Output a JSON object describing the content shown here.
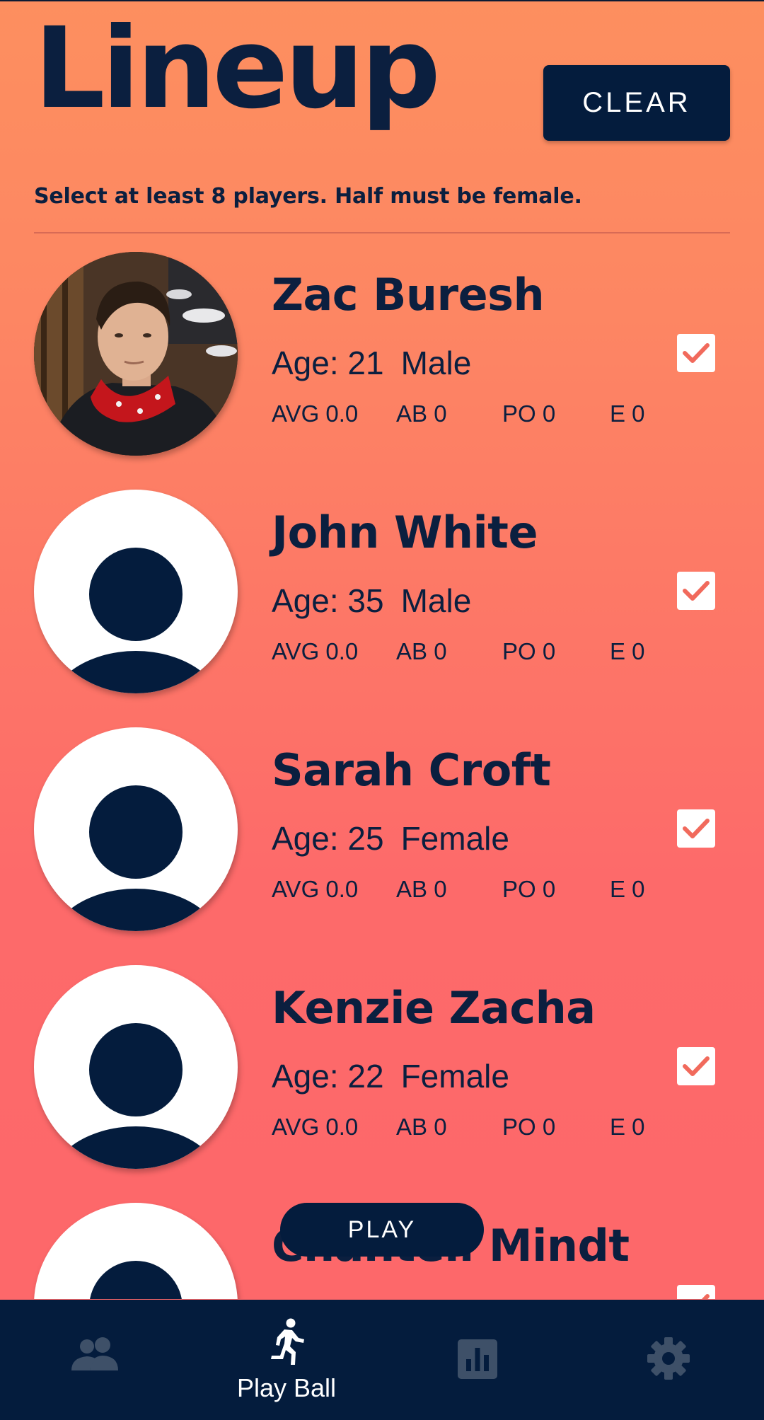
{
  "header": {
    "title": "Lineup",
    "clear_label": "CLEAR",
    "subtitle": "Select at least 8 players. Half must be female."
  },
  "players": [
    {
      "name": "Zac Buresh",
      "age_label": "Age: 21",
      "gender": "Male",
      "avg": "AVG 0.0",
      "ab": "AB 0",
      "po": "PO 0",
      "e": "E  0",
      "selected": true,
      "avatar": "photo"
    },
    {
      "name": "John White",
      "age_label": "Age: 35",
      "gender": "Male",
      "avg": "AVG 0.0",
      "ab": "AB 0",
      "po": "PO 0",
      "e": "E  0",
      "selected": true,
      "avatar": "default-user-icon"
    },
    {
      "name": "Sarah Croft",
      "age_label": "Age: 25",
      "gender": "Female",
      "avg": "AVG 0.0",
      "ab": "AB 0",
      "po": "PO 0",
      "e": "E  0",
      "selected": true,
      "avatar": "default-user-icon"
    },
    {
      "name": "Kenzie Zacha",
      "age_label": "Age: 22",
      "gender": "Female",
      "avg": "AVG 0.0",
      "ab": "AB 0",
      "po": "PO 0",
      "e": "E  0",
      "selected": true,
      "avatar": "default-user-icon"
    },
    {
      "name": "Chantell Mindt",
      "selected": true,
      "avatar": "default-user-icon"
    }
  ],
  "play_label": "PLAY",
  "nav": {
    "items": [
      {
        "icon": "people-icon",
        "label": ""
      },
      {
        "icon": "running-person-icon",
        "label": "Play Ball",
        "active": true
      },
      {
        "icon": "bar-chart-icon",
        "label": ""
      },
      {
        "icon": "gear-icon",
        "label": ""
      }
    ]
  },
  "colors": {
    "navy": "#041c3d",
    "check": "#f16a5c",
    "inactive_icon": "#3e5068",
    "bg_top": "#fd8f5f",
    "bg_bottom": "#fd676a"
  }
}
